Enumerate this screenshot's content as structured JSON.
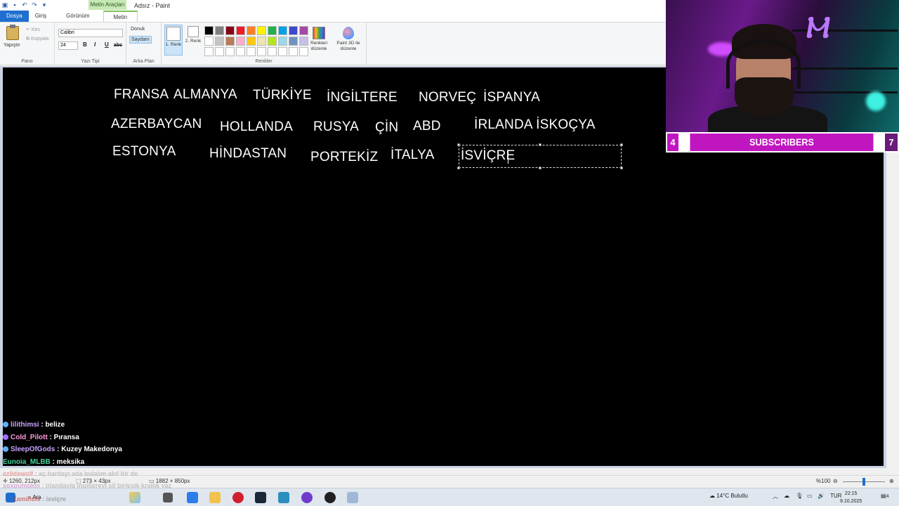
{
  "window": {
    "title": "Adsız - Paint",
    "context_tab": "Metin Araçları"
  },
  "tabs": [
    {
      "label": "Dosya"
    },
    {
      "label": "Giriş"
    },
    {
      "label": "Görünüm"
    },
    {
      "label": "Metin"
    }
  ],
  "ribbon": {
    "clipboard": {
      "paste": "Yapıştır",
      "cut": "Kes",
      "copy": "Kopyala",
      "group": "Pano"
    },
    "font": {
      "family": "Calibri",
      "size": "24",
      "bold": "B",
      "italic": "I",
      "underline": "U",
      "strike": "abc",
      "group": "Yazı Tipi"
    },
    "background": {
      "opaque": "Donuk",
      "transparent": "Saydam",
      "group": "Arka Plan"
    },
    "colors": {
      "color1_label": "1. Renk",
      "color2_label": "2. Renk",
      "edit_colors": "Renkleri düzenle",
      "group": "Renkler",
      "palette": [
        "#000000",
        "#7f7f7f",
        "#880015",
        "#ed1c24",
        "#ff7f27",
        "#fff200",
        "#22b14c",
        "#00a2e8",
        "#3f48cc",
        "#a349a4",
        "#ffffff",
        "#c3c3c3",
        "#b97a57",
        "#ffaec9",
        "#ffc90e",
        "#efe4b0",
        "#b5e61d",
        "#99d9ea",
        "#7092be",
        "#c8bfe7",
        "#ffffff",
        "#ffffff",
        "#ffffff",
        "#ffffff",
        "#ffffff",
        "#ffffff",
        "#ffffff",
        "#ffffff",
        "#ffffff",
        "#ffffff"
      ]
    },
    "paint3d": "Paint 3D ile düzenle"
  },
  "canvas": {
    "words": [
      {
        "text": "FRANSA"
      },
      {
        "text": "ALMANYA"
      },
      {
        "text": "TÜRKİYE"
      },
      {
        "text": "İNGİLTERE"
      },
      {
        "text": "NORVEÇ"
      },
      {
        "text": "İSPANYA"
      },
      {
        "text": "AZERBAYCAN"
      },
      {
        "text": "HOLLANDA"
      },
      {
        "text": "RUSYA"
      },
      {
        "text": "ÇİN"
      },
      {
        "text": "ABD"
      },
      {
        "text": "İRLANDA İSKOÇYA"
      },
      {
        "text": "ESTONYA"
      },
      {
        "text": "HİNDASTAN"
      },
      {
        "text": "PORTEKİZ"
      },
      {
        "text": "İTALYA"
      }
    ],
    "active_text": "İSVİÇRE"
  },
  "overlay": {
    "subscribers": {
      "left": "4",
      "label": "SUBSCRIBERS",
      "right": "7"
    },
    "chat": [
      {
        "user": "lilithimsi",
        "msg": "belize",
        "color": "#c9a3ff"
      },
      {
        "user": "Cold_Pilott",
        "msg": "Pıransa",
        "color": "#ff9de0"
      },
      {
        "user": "SleepOfGods",
        "msg": "Kuzey Makedonya",
        "color": "#c9a3ff"
      },
      {
        "user": "Eunoia_MLBB",
        "msg": "meksika",
        "color": "#45d49a"
      }
    ],
    "chat_faded": [
      {
        "user": "ezildxwolf",
        "msg": "aç haritayı ada bulalım akıl bir de"
      },
      {
        "user": "xoxpumpkin",
        "msg": "irlandayla ingiltereyi sil birleşik krallık yaz"
      },
      {
        "user": "Zamihuls",
        "msg": "isviçre"
      }
    ]
  },
  "statusbar": {
    "cursor": "1260, 212px",
    "selection": "273 × 43px",
    "canvas_size": "1882 × 850px",
    "zoom": "%100"
  },
  "taskbar": {
    "search": "Ara",
    "weather": "14°C Bulutlu",
    "lang": "TUR",
    "time": "22:15",
    "date": "9.10.2025",
    "notif": "4"
  }
}
